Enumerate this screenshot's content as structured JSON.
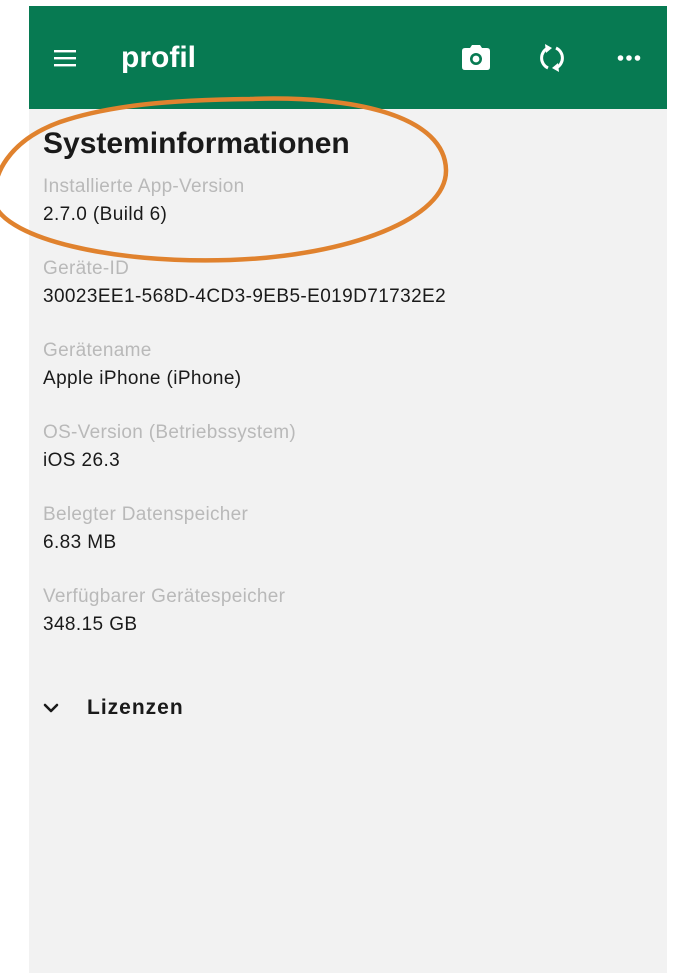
{
  "header": {
    "title": "profil",
    "background_color": "#077a52",
    "icons": [
      "menu-icon",
      "camera-icon",
      "sync-icon",
      "more-icon"
    ]
  },
  "section": {
    "title": "Systeminformationen",
    "items": [
      {
        "label": "Installierte App-Version",
        "value": "2.7.0 (Build 6)"
      },
      {
        "label": "Geräte-ID",
        "value": "30023EE1-568D-4CD3-9EB5-E019D71732E2"
      },
      {
        "label": "Gerätename",
        "value": "Apple iPhone (iPhone)"
      },
      {
        "label": "OS-Version (Betriebssystem)",
        "value": "iOS 26.3"
      },
      {
        "label": "Belegter Datenspeicher",
        "value": "6.83 MB"
      },
      {
        "label": "Verfügbarer Gerätespeicher",
        "value": "348.15 GB"
      }
    ]
  },
  "licenses": {
    "label": "Lizenzen",
    "icon": "chevron-down-icon"
  },
  "annotation": {
    "shape": "ellipse",
    "color": "#e0822e"
  }
}
